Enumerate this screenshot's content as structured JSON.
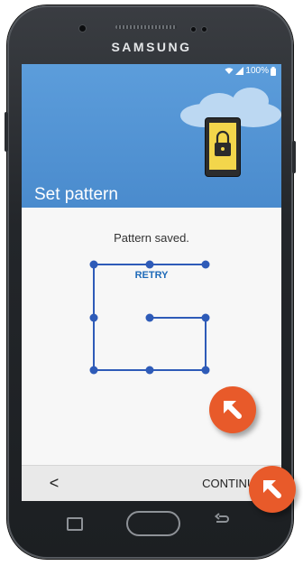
{
  "device": {
    "brand": "SAMSUNG"
  },
  "status_bar": {
    "battery": "100%"
  },
  "header": {
    "title": "Set pattern"
  },
  "content": {
    "message": "Pattern saved.",
    "retry_label": "RETRY"
  },
  "footer": {
    "back_label": "<",
    "continue_label": "CONTINUE"
  },
  "colors": {
    "header_blue": "#4a8bcd",
    "pattern_blue": "#2e5bb8",
    "hint_orange": "#e85a2a"
  },
  "icons": [
    "wifi-icon",
    "signal-icon",
    "battery-icon",
    "padlock-icon",
    "chevron-right-icon",
    "pointer-arrow-icon"
  ]
}
